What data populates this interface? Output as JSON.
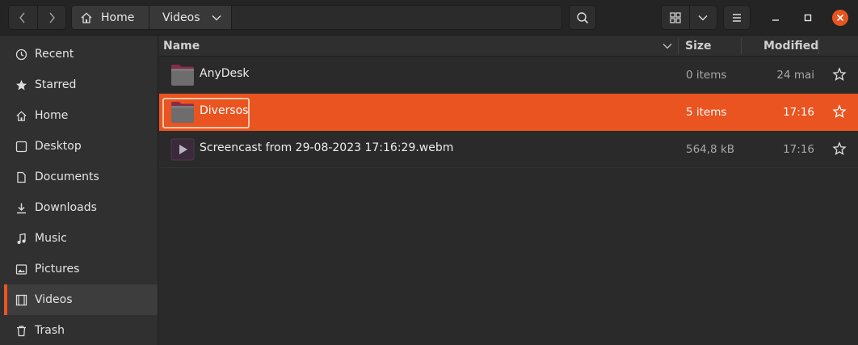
{
  "header": {
    "path": [
      {
        "label": "Home",
        "icon": "home-icon"
      },
      {
        "label": "Videos",
        "icon": "chevron-down-icon"
      }
    ],
    "buttons": [
      "back-icon",
      "forward-icon",
      "search-icon",
      "grid-view-icon",
      "view-options-chevron-icon",
      "menu-icon",
      "minimize-icon",
      "maximize-icon",
      "close-icon"
    ],
    "close_color": "#e95420"
  },
  "sidebar": {
    "items": [
      {
        "label": "Recent",
        "icon": "clock-icon"
      },
      {
        "label": "Starred",
        "icon": "star-icon"
      },
      {
        "label": "Home",
        "icon": "home-icon"
      },
      {
        "label": "Desktop",
        "icon": "desktop-icon"
      },
      {
        "label": "Documents",
        "icon": "document-icon"
      },
      {
        "label": "Downloads",
        "icon": "download-icon"
      },
      {
        "label": "Music",
        "icon": "music-icon"
      },
      {
        "label": "Pictures",
        "icon": "picture-icon"
      },
      {
        "label": "Videos",
        "icon": "video-icon",
        "active": true
      },
      {
        "label": "Trash",
        "icon": "trash-icon"
      }
    ]
  },
  "list": {
    "columns": {
      "name": "Name",
      "size": "Size",
      "modified": "Modified"
    },
    "rows": [
      {
        "name": "AnyDesk",
        "size": "0 items",
        "modified": "24 mai",
        "icon": "folder-icon"
      },
      {
        "name": "Diversos",
        "size": "5 items",
        "modified": "17:16",
        "icon": "folder-icon",
        "selected": true
      },
      {
        "name": "Screencast from 29-08-2023 17:16:29.webm",
        "size": "564,8 kB",
        "modified": "17:16",
        "icon": "video-file-icon"
      }
    ]
  },
  "colors": {
    "accent": "#e95420",
    "background": "#2a2a2a",
    "sidebar": "#303030"
  }
}
